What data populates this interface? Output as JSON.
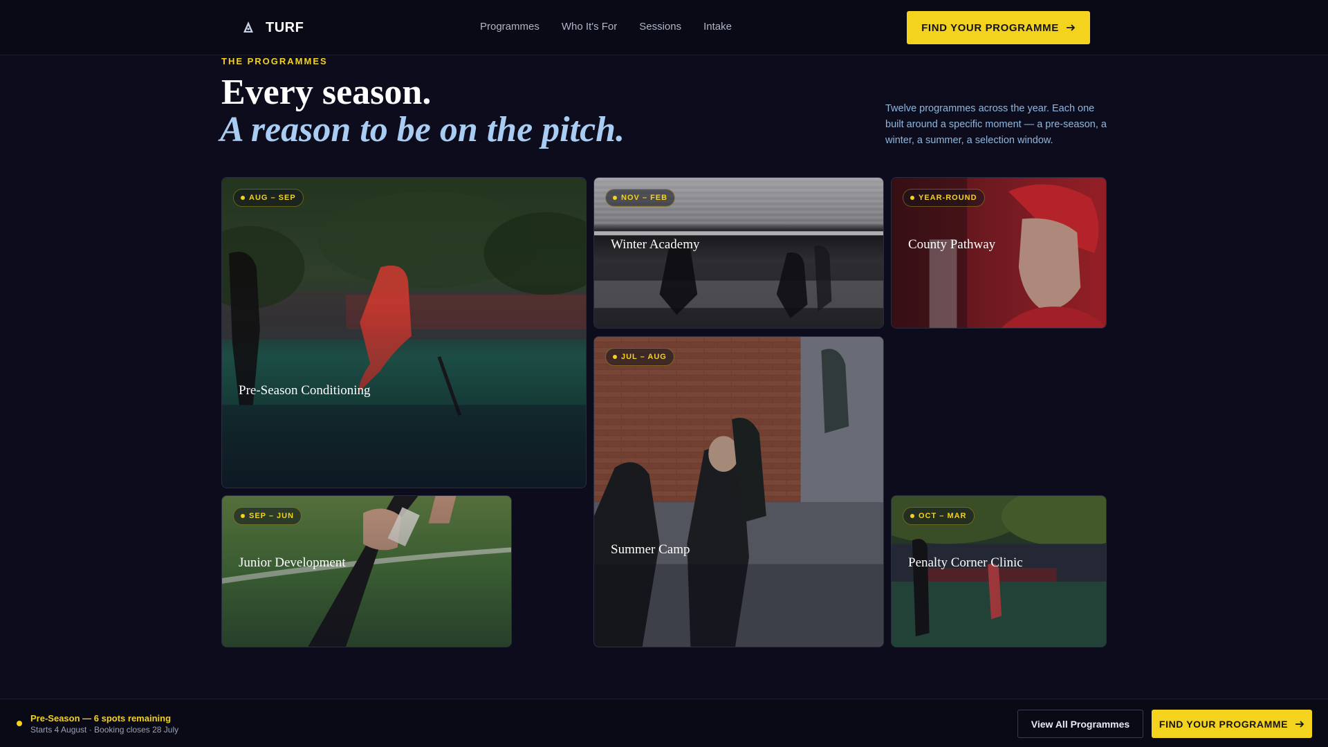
{
  "nav": {
    "brand": "TURF",
    "links": [
      "Programmes",
      "Who It's For",
      "Sessions",
      "Intake"
    ],
    "cta": "FIND YOUR PROGRAMME"
  },
  "hero": {
    "eyebrow": "THE PROGRAMMES",
    "title_line1": "Every season.",
    "title_line2": "A reason to be on the pitch.",
    "lede": "Twelve programmes across the year. Each one built around a specific moment — a pre-season, a winter, a summer, a selection window."
  },
  "programmes": [
    {
      "season": "AUG – SEP",
      "title": "Pre-Season Conditioning"
    },
    {
      "season": "NOV – FEB",
      "title": "Winter Academy"
    },
    {
      "season": "YEAR-ROUND",
      "title": "County Pathway"
    },
    {
      "season": "JUL – AUG",
      "title": "Summer Camp"
    },
    {
      "season": "SEP – JUN",
      "title": "Junior Development"
    },
    {
      "season": "OCT – MAR",
      "title": "Penalty Corner Clinic"
    }
  ],
  "footer": {
    "status_title": "Pre-Season — 6 spots remaining",
    "status_sub": "Starts 4 August · Booking closes 28 July",
    "secondary": "View All Programmes",
    "cta": "FIND YOUR PROGRAMME"
  },
  "colors": {
    "accent": "#f3d31d",
    "background": "#0c0c1c",
    "italic_title": "#a9cdf2"
  }
}
